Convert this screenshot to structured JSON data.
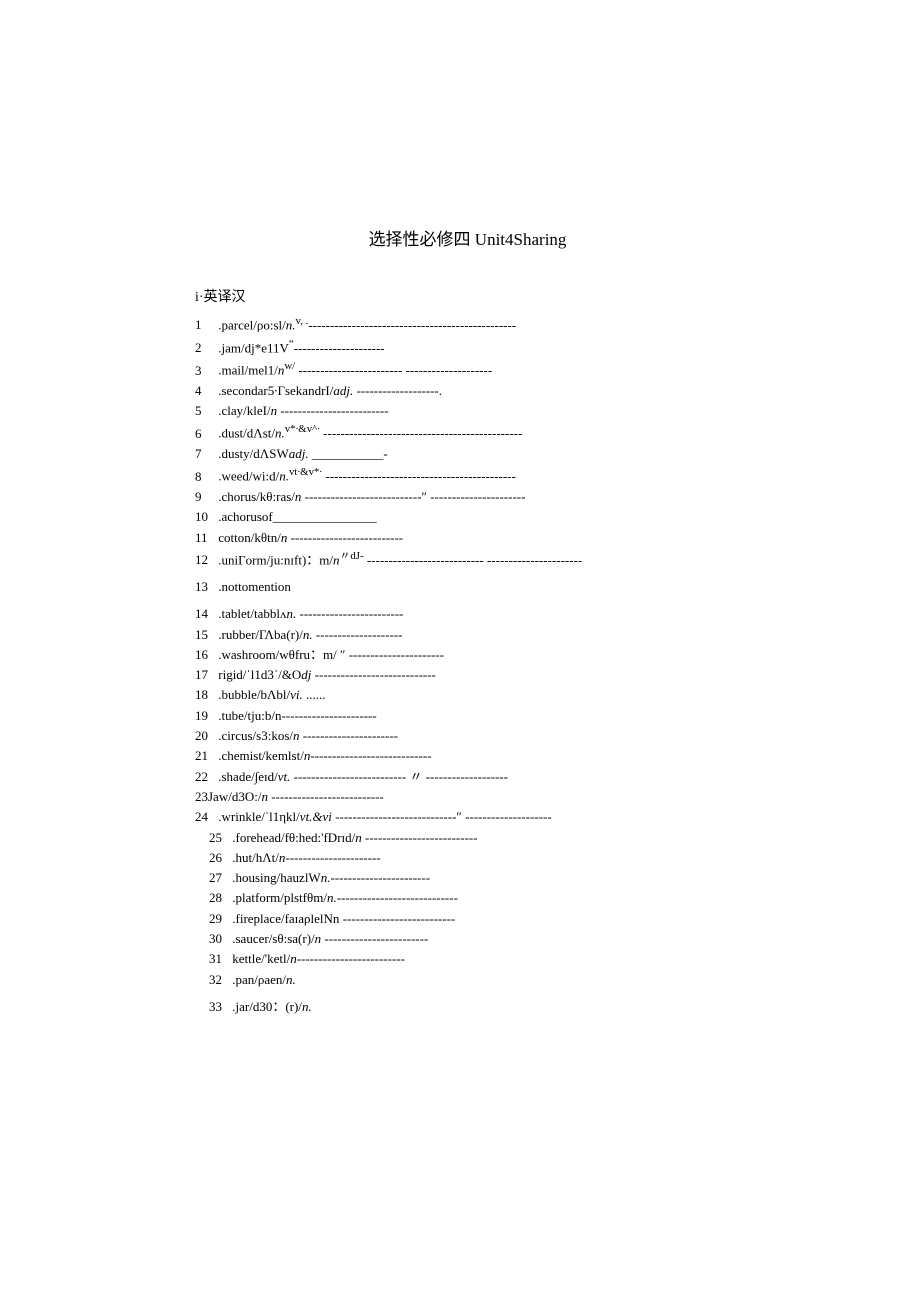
{
  "title": "选择性必修四 Unit4Sharing",
  "sectionHead": "i·英译汉",
  "entries": [
    {
      "num": "1",
      "text": ".parcel/ρo:sl/",
      "pos": "n.",
      "sup": "v, .",
      "dashes": "------------------------------------------------"
    },
    {
      "num": "2",
      "text": ".jam/dj*e11V",
      "sup": "“",
      "dashes": "---------------------"
    },
    {
      "num": "3",
      "text": ".mail/mel1/",
      "pos": "n",
      "dashes": " -----------------------",
      "sup": "w/",
      "dashes2": "- --------------------"
    },
    {
      "num": "4",
      "text": ".secondar5∙ΓsekandrI/",
      "pos": "adj.",
      "dashes": " -------------------."
    },
    {
      "num": "5",
      "text": ".clay/kleI/",
      "pos": "n",
      "dashes": " -------------------------"
    },
    {
      "num": "6",
      "text": ".dust/dΛst/",
      "pos": "n.",
      "sup": "v*∙&v^∙",
      "dashes": " ----------------------------------------------"
    },
    {
      "num": "7",
      "text": ".dusty/dΛSW",
      "pos": "adj.",
      "dashes": " ___________-"
    },
    {
      "num": "8",
      "text": ".weed/wi:d/",
      "pos": "n.",
      "sup": "vt∙&v*∙",
      "dashes": " --------------------------------------------"
    },
    {
      "num": "9",
      "text": ".chorus/kθ:ras/",
      "pos": "n",
      "dashes": " ---------------------------″ ----------------------"
    },
    {
      "num": "10",
      "text": ".achorusof",
      "dashes": "________________"
    },
    {
      "num": "11",
      "text": "cotton/kθtn/",
      "pos": "n",
      "dashes": " --------------------------"
    },
    {
      "num": "12",
      "text": ".uniΓorm/ju:nɪft)：m/",
      "pos": "n",
      "dashes": " ---------------------------",
      "sup": "〃dJ-",
      "dashes2": " ----------------------"
    },
    {
      "num": "13",
      "text": ".nottomention"
    },
    {
      "num": "14",
      "text": ".tablet/tabblʌ",
      "pos": "n.",
      "dashes": " ------------------------"
    },
    {
      "num": "15",
      "text": ".rubber/ΓΛba(r)/",
      "pos": "n.",
      "dashes": " --------------------"
    },
    {
      "num": "16",
      "text": ".washroom/wθfru：m/ ″ ",
      "dashes": "----------------------"
    },
    {
      "num": "17",
      "text": "rigid/ˈl1d3ˈ/&O",
      "pos": "dj",
      "dashes": " ----------------------------"
    },
    {
      "num": "18",
      "text": ".bubble/bΛbl/",
      "pos": "vi.",
      "dashes": " ......"
    },
    {
      "num": "19",
      "text": ".tube/tju:b/n",
      "dashes": "----------------------"
    },
    {
      "num": "20",
      "text": ".circus/s3:kos/",
      "pos": "n",
      "dashes": " ----------------------"
    },
    {
      "num": "21",
      "text": ".chemist/kemlst/",
      "pos": "n",
      "dashes": "----------------------------"
    },
    {
      "num": "22",
      "text": ".shade/∫eɪd/",
      "pos": "vt.",
      "dashes": " --------------------------  〃  -------------------"
    },
    {
      "num": "23",
      "plain": true,
      "text": "23Jaw/d3O:/",
      "pos": "n",
      "dashes": " --------------------------"
    },
    {
      "num": "24",
      "text": ".wrinkle/ˈl1ηkl/",
      "pos": "vt.&vi",
      "dashes": " ----------------------------″ --------------------"
    }
  ],
  "indentedEntries": [
    {
      "num": "25",
      "text": ".forehead/fθ:hed:'fDrɪd/",
      "pos": "n",
      "dashes": " --------------------------"
    },
    {
      "num": "26",
      "text": ".hut/hΛt/",
      "pos": "n",
      "dashes": "----------------------"
    },
    {
      "num": "27",
      "text": ".housing/hauzlW",
      "pos": "n.",
      "dashes": "-----------------------"
    },
    {
      "num": "28",
      "text": ".platform/plstfθm/",
      "pos": "n.",
      "dashes": "----------------------------"
    },
    {
      "num": "29",
      "text": ".fireplace/faɪaρlelNn",
      "dashes": " --------------------------"
    },
    {
      "num": "30",
      "text": ".saucer/sθ:sa(r)/",
      "pos": "n",
      "dashes": " ------------------------"
    },
    {
      "num": "31",
      "text": "kettle/'ketl/",
      "pos": "n",
      "dashes": "-------------------------"
    },
    {
      "num": "32",
      "text": ".pan/ρaen/",
      "pos": "n."
    },
    {
      "num": "33",
      "text": ".jar/d30：(r)/",
      "pos": "n."
    }
  ]
}
